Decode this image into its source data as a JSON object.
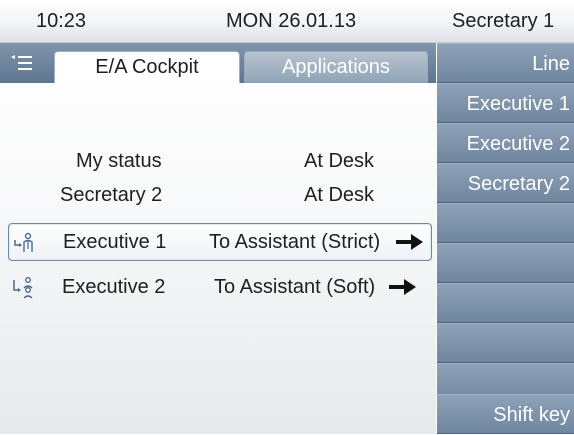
{
  "statusbar": {
    "time": "10:23",
    "date": "MON 26.01.13",
    "user": "Secretary 1"
  },
  "tabs": [
    {
      "label": "E/A Cockpit",
      "active": true
    },
    {
      "label": "Applications",
      "active": false
    }
  ],
  "status": {
    "my_status_label": "My status",
    "my_status_value": "At Desk",
    "secretary_label": "Secretary 2",
    "secretary_value": "At Desk"
  },
  "executives": [
    {
      "name": "Executive 1",
      "mode": "To Assistant (Strict)",
      "icon": "executive-forward-icon",
      "selected": true
    },
    {
      "name": "Executive 2",
      "mode": "To Assistant (Soft)",
      "icon": "executive-group-icon",
      "selected": false
    }
  ],
  "keys": [
    {
      "label": "Line"
    },
    {
      "label": "Executive 1"
    },
    {
      "label": "Executive 2"
    },
    {
      "label": "Secretary 2"
    },
    {
      "label": ""
    },
    {
      "label": ""
    },
    {
      "label": ""
    },
    {
      "label": ""
    },
    {
      "label": ""
    },
    {
      "label": "Shift key"
    }
  ],
  "colors": {
    "accent": "#6f869f",
    "selection_border": "#6f8aa7"
  }
}
